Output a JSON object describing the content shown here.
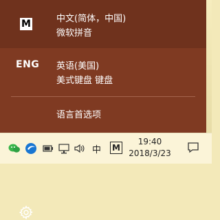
{
  "input_flyout": {
    "items": [
      {
        "badge": "M",
        "line1": "中文(简体，中国)",
        "line2": "微软拼音"
      },
      {
        "badge": "ENG",
        "line1": "英语(美国)",
        "line2": "美式键盘 键盘"
      }
    ],
    "preferences_label": "语言首选项"
  },
  "taskbar": {
    "ime_char": "中",
    "ime_badge": "M",
    "time": "19:40",
    "date": "2018/3/23"
  }
}
